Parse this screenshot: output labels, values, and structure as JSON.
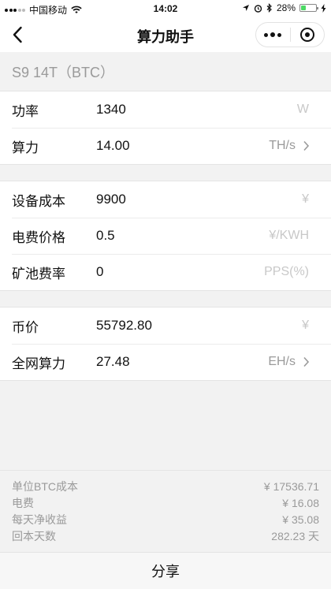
{
  "status_bar": {
    "carrier": "中国移动",
    "time": "14:02",
    "battery_percent": "28%",
    "battery_level": 0.28,
    "icons": [
      "signal-dots-icon",
      "wifi-icon",
      "location-arrow-icon",
      "alarm-icon",
      "bluetooth-icon",
      "battery-icon",
      "charging-bolt-icon"
    ]
  },
  "nav": {
    "title": "算力助手",
    "icons": [
      "back-chevron-icon",
      "more-dots-icon",
      "close-target-icon"
    ]
  },
  "device": {
    "name": "S9 14T（BTC）"
  },
  "groups": {
    "machine": {
      "power": {
        "label": "功率",
        "value": "1340",
        "unit": "W"
      },
      "hashrate": {
        "label": "算力",
        "value": "14.00",
        "unit": "TH/s"
      }
    },
    "costs": {
      "device_cost": {
        "label": "设备成本",
        "value": "9900",
        "unit": "¥"
      },
      "electricity_price": {
        "label": "电费价格",
        "value": "0.5",
        "unit": "¥/KWH"
      },
      "pool_fee": {
        "label": "矿池费率",
        "value": "0",
        "unit": "PPS(%)"
      }
    },
    "network": {
      "coin_price": {
        "label": "币价",
        "value": "55792.80",
        "unit": "¥"
      },
      "network_hashrate": {
        "label": "全网算力",
        "value": "27.48",
        "unit": "EH/s"
      }
    }
  },
  "results": [
    {
      "label": "单位BTC成本",
      "value": "¥ 17536.71"
    },
    {
      "label": "电费",
      "value": "¥ 16.08"
    },
    {
      "label": "每天净收益",
      "value": "¥ 35.08"
    },
    {
      "label": "回本天数",
      "value": "282.23 天"
    }
  ],
  "share": {
    "label": "分享"
  },
  "colors": {
    "background": "#f2f2f2",
    "surface": "#ffffff",
    "text": "#111111",
    "muted": "#9a9a9a",
    "placeholder_unit": "#c8c8c8",
    "battery_green": "#4cd964"
  }
}
